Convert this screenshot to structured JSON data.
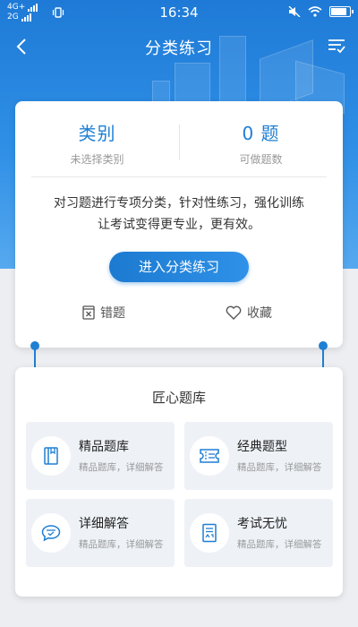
{
  "status_bar": {
    "network_top": "4G+",
    "network_bottom": "2G",
    "time": "16:34"
  },
  "nav": {
    "title": "分类练习"
  },
  "summary": {
    "category_value": "类别",
    "category_label": "未选择类别",
    "count_value": "0 题",
    "count_label": "可做题数"
  },
  "description": {
    "line1": "对习题进行专项分类，针对性练习，强化训练",
    "line2": "让考试变得更专业，更有效。"
  },
  "enter_button": "进入分类练习",
  "actions": {
    "wrong_label": "错题",
    "favorite_label": "收藏"
  },
  "bank": {
    "title": "匠心题库",
    "tiles": [
      {
        "title": "精品题库",
        "subtitle": "精品题库，详细解答",
        "icon": "book-icon"
      },
      {
        "title": "经典题型",
        "subtitle": "精品题库，详细解答",
        "icon": "ticket-icon"
      },
      {
        "title": "详细解答",
        "subtitle": "精品题库，详细解答",
        "icon": "chat-bubble-icon"
      },
      {
        "title": "考试无忧",
        "subtitle": "精品题库，详细解答",
        "icon": "exam-paper-icon"
      }
    ]
  },
  "colors": {
    "accent": "#1f7fd3",
    "header_top": "#1e7ad6",
    "header_bottom": "#56a9ef",
    "background": "#eceef2",
    "tile_background": "#eef2f7"
  }
}
